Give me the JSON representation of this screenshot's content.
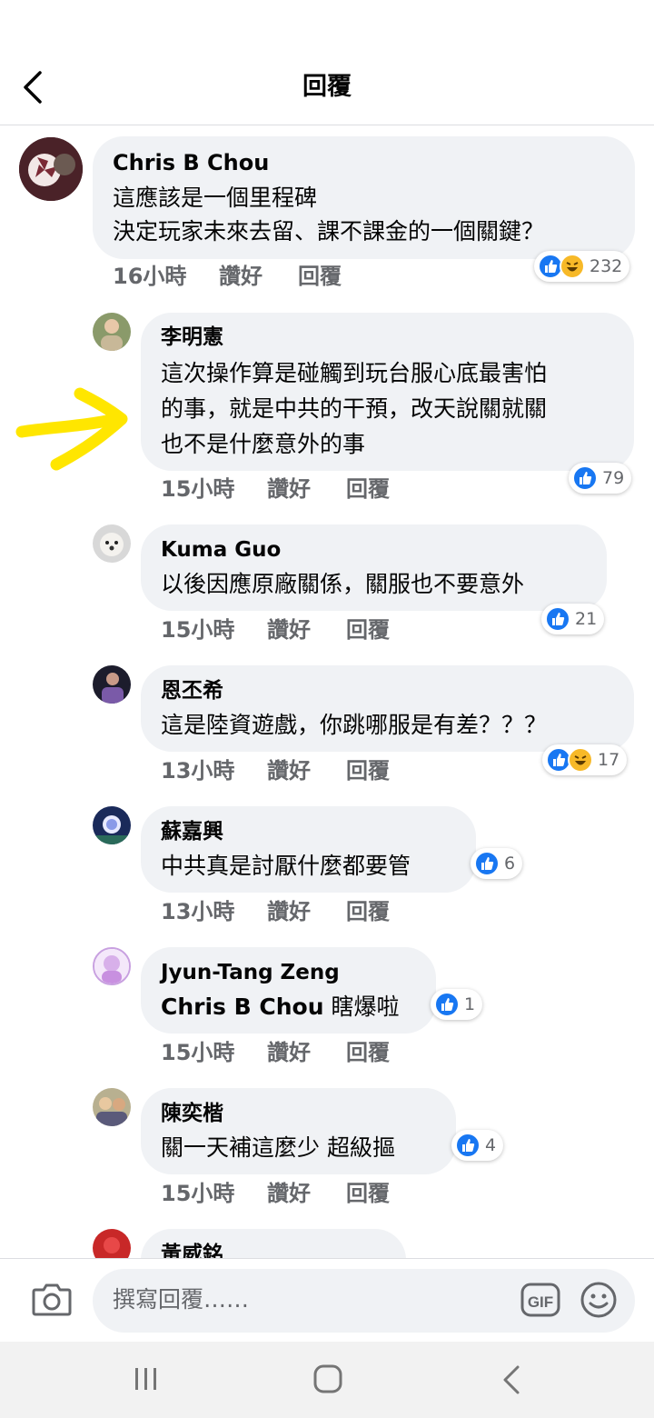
{
  "header": {
    "title": "回覆"
  },
  "comments": [
    {
      "author": "Chris B Chou",
      "lines": [
        "這應該是一個里程碑",
        "決定玩家未來去留、課不課金的一個關鍵？"
      ],
      "time": "16小時",
      "like_label": "讚好",
      "reply_label": "回覆",
      "reactions": [
        "like",
        "haha"
      ],
      "reaction_count": "232"
    },
    {
      "author": "李明憲",
      "lines": [
        "這次操作算是碰觸到玩台服心底最害怕",
        "的事，就是中共的干預，改天說關就關",
        "也不是什麼意外的事"
      ],
      "time": "15小時",
      "like_label": "讚好",
      "reply_label": "回覆",
      "reactions": [
        "like"
      ],
      "reaction_count": "79"
    },
    {
      "author": "Kuma Guo",
      "lines": [
        "以後因應原廠關係，關服也不要意外"
      ],
      "time": "15小時",
      "like_label": "讚好",
      "reply_label": "回覆",
      "reactions": [
        "like"
      ],
      "reaction_count": "21"
    },
    {
      "author": "恩丕希",
      "lines": [
        "這是陸資遊戲，你跳哪服是有差？？？"
      ],
      "time": "13小時",
      "like_label": "讚好",
      "reply_label": "回覆",
      "reactions": [
        "like",
        "haha"
      ],
      "reaction_count": "17"
    },
    {
      "author": "蘇嘉興",
      "lines": [
        "中共真是討厭什麼都要管"
      ],
      "time": "13小時",
      "like_label": "讚好",
      "reply_label": "回覆",
      "reactions": [
        "like"
      ],
      "reaction_count": "6"
    },
    {
      "author": "Jyun-Tang Zeng",
      "mention": "Chris B Chou",
      "mention_text": " 瞎爆啦",
      "time": "15小時",
      "like_label": "讚好",
      "reply_label": "回覆",
      "reactions": [
        "like"
      ],
      "reaction_count": "1"
    },
    {
      "author": "陳奕楷",
      "lines": [
        "關一天補這麼少 超級摳"
      ],
      "time": "15小時",
      "like_label": "讚好",
      "reply_label": "回覆",
      "reactions": [
        "like"
      ],
      "reaction_count": "4"
    },
    {
      "author": "黃威銘"
    }
  ],
  "composer": {
    "placeholder": "撰寫回覆……",
    "gif_label": "GIF"
  },
  "icons": {
    "back": "chevron-left-icon",
    "camera": "camera-icon",
    "gif": "gif-icon",
    "emoji": "emoji-icon",
    "like": "like-reaction-icon",
    "haha": "haha-reaction-icon",
    "nav_recents": "recent-apps-icon",
    "nav_home": "home-icon",
    "nav_back": "back-icon"
  },
  "colors": {
    "like": "#1877f2",
    "haha": "#f7b928",
    "bubble": "#f0f2f5",
    "secondary_text": "#65676b",
    "annotation_arrow": "#ffe600"
  }
}
